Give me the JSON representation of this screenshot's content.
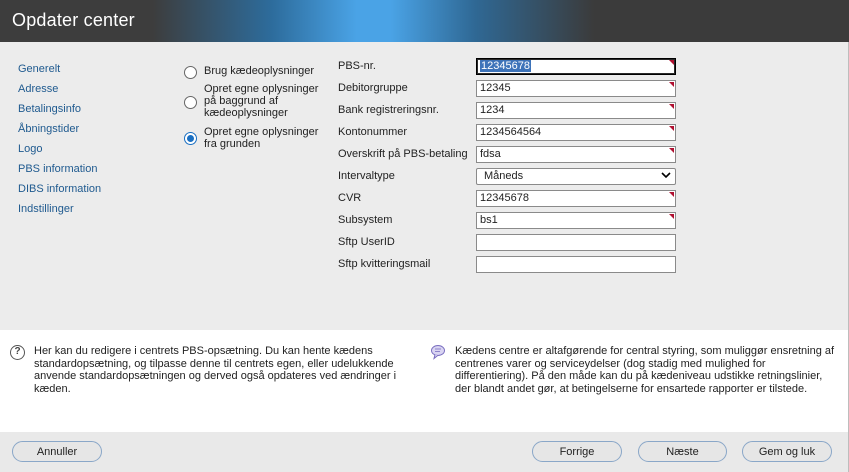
{
  "window": {
    "title": "Opdater center"
  },
  "nav": {
    "items": [
      {
        "label": "Generelt"
      },
      {
        "label": "Adresse"
      },
      {
        "label": "Betalingsinfo"
      },
      {
        "label": "Åbningstider"
      },
      {
        "label": "Logo"
      },
      {
        "label": "PBS information"
      },
      {
        "label": "DIBS information"
      },
      {
        "label": "Indstillinger"
      }
    ]
  },
  "options": {
    "selected_index": 2,
    "items": [
      {
        "label": "Brug kædeoplysninger"
      },
      {
        "label": "Opret egne oplysninger på baggrund af kædeoplysninger"
      },
      {
        "label": "Opret egne oplysninger fra grunden"
      }
    ]
  },
  "form": {
    "fields": [
      {
        "label": "PBS-nr.",
        "value": "12345678",
        "required": true
      },
      {
        "label": "Debitorgruppe",
        "value": "12345",
        "required": true
      },
      {
        "label": "Bank registreringsnr.",
        "value": "1234",
        "required": true
      },
      {
        "label": "Kontonummer",
        "value": "1234564564",
        "required": true
      },
      {
        "label": "Overskrift på PBS-betaling",
        "value": "fdsa",
        "required": true
      },
      {
        "label": "Intervaltype",
        "value": "Måneds",
        "required": false
      },
      {
        "label": "CVR",
        "value": "12345678",
        "required": true
      },
      {
        "label": "Subsystem",
        "value": "bs1",
        "required": true
      },
      {
        "label": "Sftp UserID",
        "value": "",
        "required": false
      },
      {
        "label": "Sftp kvitteringsmail",
        "value": "",
        "required": false
      }
    ]
  },
  "help": {
    "left_text": "Her kan du redigere i centrets PBS-opsætning. Du kan hente kædens standardopsætning, og tilpasse denne til centrets egen, eller udelukkende anvende standardopsætningen og derved også opdateres ved ændringer i kæden.",
    "right_text": "Kædens centre er altafgørende for central styring, som muliggør ensretning af centrenes varer og serviceydelser (dog stadig med mulighed for differentiering). På den måde kan du på kædeniveau udstikke retningslinier, der blandt andet gør, at betingelserne for ensartede rapporter er tilstede.",
    "help_icon": "help-question-icon",
    "tip_icon": "speech-bubble-icon"
  },
  "footer": {
    "cancel_label": "Annuller",
    "prev_label": "Forrige",
    "next_label": "Næste",
    "save_label": "Gem og luk"
  },
  "colors": {
    "title_gradient_accent": "#4aa3e6",
    "link": "#1f5a8f",
    "required_marker": "#b01030",
    "button_border": "#8aa7c8"
  }
}
